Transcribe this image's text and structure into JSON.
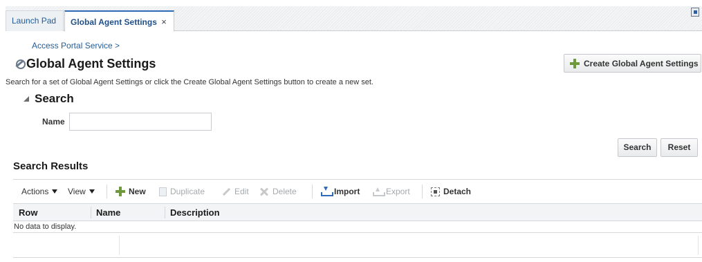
{
  "tabs": [
    {
      "label": "Launch Pad"
    },
    {
      "label": "Global Agent Settings",
      "close": "×"
    }
  ],
  "breadcrumb": "Access Portal Service >",
  "page": {
    "title": "Global Agent Settings",
    "instructions": "Search for a set of Global Agent Settings or click the Create Global Agent Settings button to create a new set.",
    "create_button": "Create Global Agent Settings"
  },
  "search": {
    "title": "Search",
    "name_label": "Name",
    "name_value": "",
    "search_button": "Search",
    "reset_button": "Reset"
  },
  "results": {
    "title": "Search Results",
    "toolbar": {
      "actions": "Actions",
      "view": "View",
      "new": "New",
      "duplicate": "Duplicate",
      "edit": "Edit",
      "delete": "Delete",
      "import": "Import",
      "export": "Export",
      "detach": "Detach"
    },
    "columns": [
      "Row",
      "Name",
      "Description"
    ],
    "empty_message": "No data to display."
  },
  "icons": {
    "title": "settings-wrench-icon",
    "create": "plus-icon",
    "window": "detach-window-icon"
  }
}
